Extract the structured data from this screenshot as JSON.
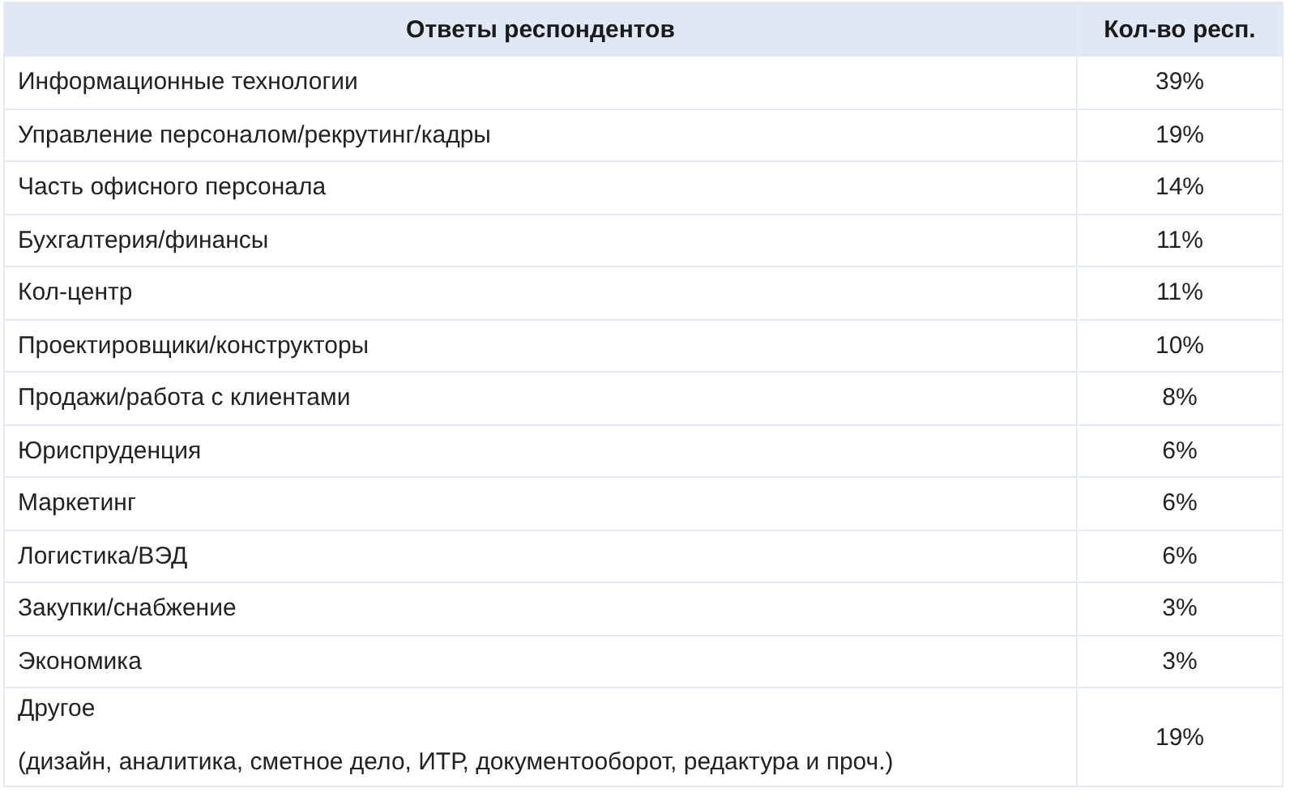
{
  "table": {
    "columns": [
      "Ответы респондентов",
      "Кол-во респ."
    ],
    "rows": [
      {
        "answer": "Информационные технологии",
        "share": "39%"
      },
      {
        "answer": "Управление персоналом/рекрутинг/кадры",
        "share": "19%"
      },
      {
        "answer": "Часть офисного персонала",
        "share": "14%"
      },
      {
        "answer": "Бухгалтерия/финансы",
        "share": "11%"
      },
      {
        "answer": "Кол-центр",
        "share": "11%"
      },
      {
        "answer": "Проектировщики/конструкторы",
        "share": "10%"
      },
      {
        "answer": "Продажи/работа с клиентами",
        "share": "8%"
      },
      {
        "answer": "Юриспруденция",
        "share": "6%"
      },
      {
        "answer": "Маркетинг",
        "share": "6%"
      },
      {
        "answer": "Логистика/ВЭД",
        "share": "6%"
      },
      {
        "answer": "Закупки/снабжение",
        "share": "3%"
      },
      {
        "answer": "Экономика",
        "share": "3%"
      },
      {
        "answer": "Другое",
        "note": "(дизайн, аналитика, сметное дело, ИТР, документооборот, редактура и проч.)",
        "share": "19%"
      }
    ]
  }
}
